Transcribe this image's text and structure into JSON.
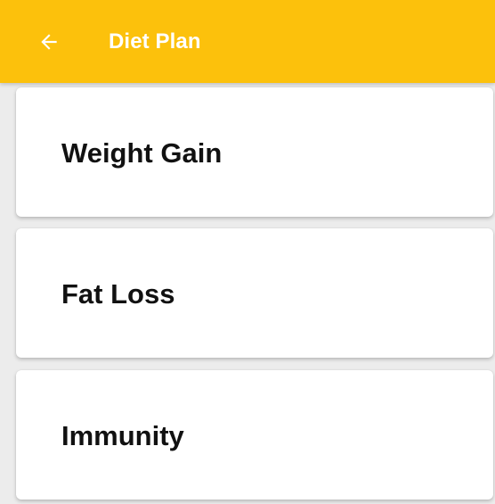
{
  "app_bar": {
    "title": "Diet Plan",
    "back_icon": "arrow-left-icon",
    "background_color": "#fcc10c",
    "title_color": "#ffffff"
  },
  "plans": [
    {
      "label": "Weight Gain"
    },
    {
      "label": "Fat Loss"
    },
    {
      "label": "Immunity"
    }
  ]
}
